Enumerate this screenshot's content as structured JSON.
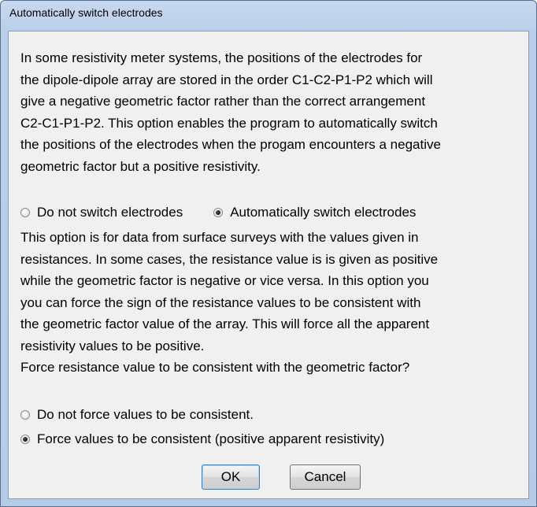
{
  "window": {
    "title": "Automatically switch electrodes"
  },
  "section1": {
    "lines": [
      "In some resistivity meter systems, the positions of the electrodes for",
      "the dipole-dipole array are stored in the order C1-C2-P1-P2 which will",
      "give a negative geometric factor rather than the correct arrangement",
      "C2-C1-P1-P2. This option enables the program to automatically switch",
      "the positions of the electrodes when the progam encounters a negative",
      "geometric factor but a positive resistivity."
    ]
  },
  "switch_options": {
    "option1": "Do not switch electrodes",
    "option2": "Automatically switch electrodes",
    "selected": "option2"
  },
  "section2": {
    "lines": [
      "This option is for data from surface surveys with the values given in",
      "resistances. In some cases, the resistance value is is given as positive",
      "while the geometric factor is negative or vice versa. In this option you",
      "you can force the sign of the resistance values to be consistent with",
      "the geometric factor value of the array. This will force all the apparent",
      "resistivity values to be positive.",
      "Force resistance value to be consistent with the geometric factor?"
    ]
  },
  "force_options": {
    "option1": "Do not force values to be consistent.",
    "option2": "Force values to be consistent (positive apparent resistivity)",
    "selected": "option2"
  },
  "buttons": {
    "ok_label": "OK",
    "cancel_label": "Cancel"
  }
}
